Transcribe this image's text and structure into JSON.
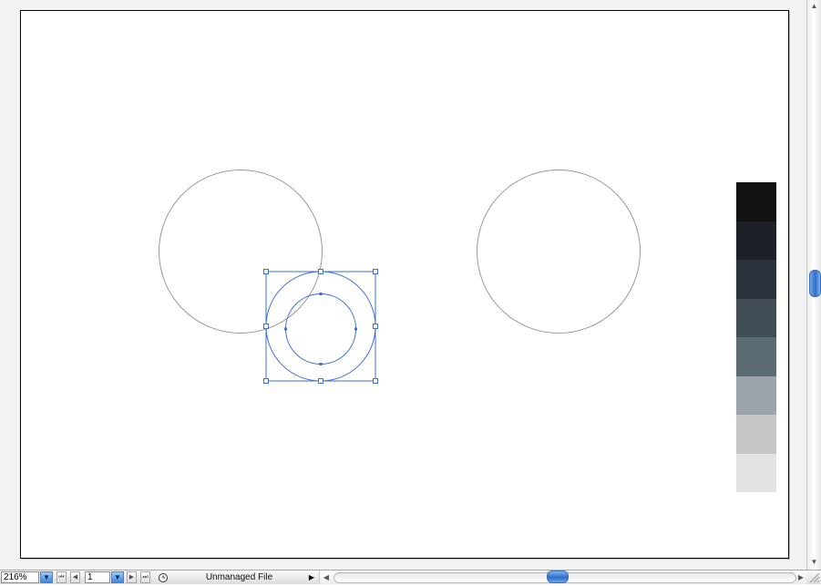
{
  "statusbar": {
    "zoom_value": "216%",
    "page_value": "1",
    "status_text": "Unmanaged File"
  },
  "icons": {
    "zoom_dropdown": "triangle-down-icon",
    "first_page": "first-page-icon",
    "prev_page": "previous-page-icon",
    "page_dropdown": "triangle-down-icon",
    "next_page": "next-page-icon",
    "last_page": "last-page-icon",
    "status_menu": "triangle-right-icon",
    "scroll_up": "triangle-up-icon",
    "scroll_down": "triangle-down-icon",
    "scroll_left": "triangle-left-icon",
    "scroll_right": "triangle-right-icon",
    "resize": "resize-grip-icon"
  },
  "colors": {
    "selection": "#3b6fd8",
    "circle_stroke": "#9a9a9a",
    "swatches": [
      "#121212",
      "#1b2127",
      "#2a323b",
      "#414d55",
      "#5b6b72",
      "#9ca3aa",
      "#c6c6c6",
      "#e3e3e3"
    ]
  }
}
